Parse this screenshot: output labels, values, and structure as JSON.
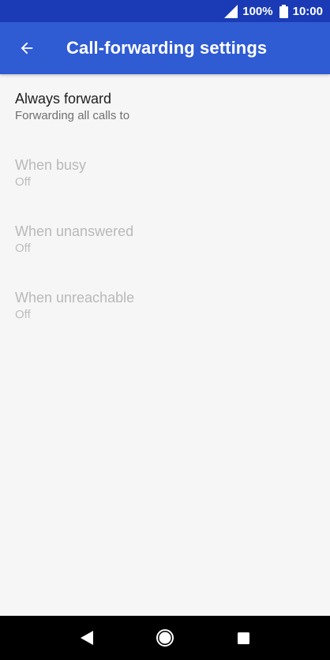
{
  "status_bar": {
    "battery_percent": "100%",
    "time": "10:00",
    "icons": [
      "signal-icon",
      "battery-icon"
    ]
  },
  "app_bar": {
    "title": "Call-forwarding settings",
    "back_icon": "arrow-back-icon",
    "colors": {
      "status_bar": "#1a3bb5",
      "app_bar": "#2f5bd3"
    }
  },
  "settings": [
    {
      "title": "Always forward",
      "summary": "Forwarding all calls to",
      "enabled": true
    },
    {
      "title": "When busy",
      "summary": "Off",
      "enabled": false
    },
    {
      "title": "When unanswered",
      "summary": "Off",
      "enabled": false
    },
    {
      "title": "When unreachable",
      "summary": "Off",
      "enabled": false
    }
  ],
  "nav_bar": {
    "icons": [
      "nav-back-icon",
      "nav-home-icon",
      "nav-recents-icon"
    ]
  }
}
